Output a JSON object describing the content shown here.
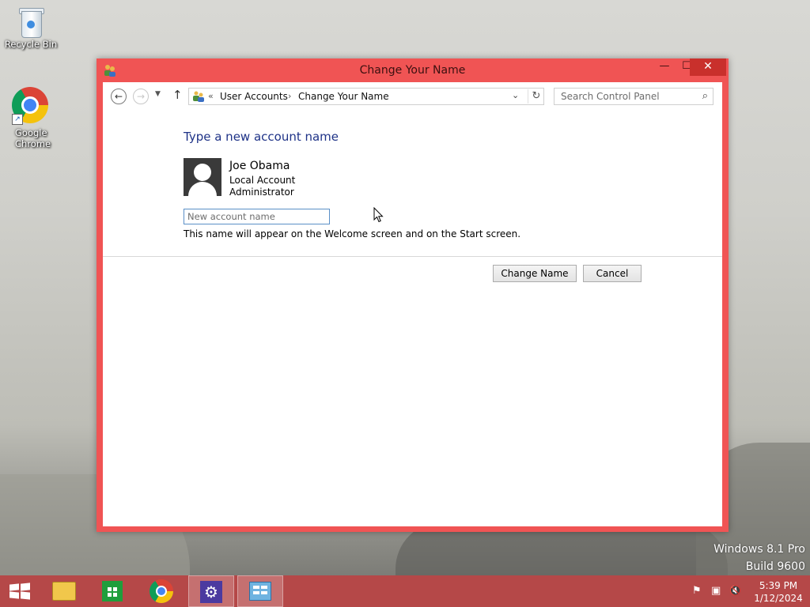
{
  "desktop": {
    "icons": [
      {
        "label": "Recycle Bin"
      },
      {
        "label": "Google Chrome"
      }
    ],
    "watermark": {
      "line1": "Windows 8.1 Pro",
      "line2": "Build 9600"
    }
  },
  "window": {
    "title": "Change Your Name",
    "controls": {
      "minimize": "—",
      "maximize": "☐",
      "close": "✕"
    },
    "nav": {
      "back": "←",
      "forward": "→",
      "recent": "▼",
      "up": "↑",
      "breadcrumb": {
        "overflow": "«",
        "items": [
          "User Accounts",
          "Change Your Name"
        ],
        "separator": "›"
      },
      "dropdown": "⌄",
      "refresh": "↻",
      "search_placeholder": "Search Control Panel",
      "search_icon": "⌕"
    },
    "content": {
      "heading": "Type a new account name",
      "user": {
        "name": "Joe Obama",
        "type": "Local Account",
        "role": "Administrator"
      },
      "input": {
        "value": "",
        "placeholder": "New account name"
      },
      "hint": "This name will appear on the Welcome screen and on the Start screen.",
      "buttons": {
        "change": "Change Name",
        "cancel": "Cancel"
      }
    }
  },
  "taskbar": {
    "items": [
      {
        "name": "start",
        "icon": "windows-logo-icon"
      },
      {
        "name": "file-explorer",
        "icon": "folder-icon"
      },
      {
        "name": "store",
        "icon": "store-icon"
      },
      {
        "name": "chrome",
        "icon": "chrome-icon"
      },
      {
        "name": "settings",
        "icon": "gear-icon",
        "active": true
      },
      {
        "name": "control-panel",
        "icon": "control-panel-icon",
        "active": true
      }
    ],
    "tray": {
      "flag": "⚑",
      "network": "▣",
      "volume": "🔇",
      "time": "5:39 PM",
      "date": "1/12/2024"
    }
  }
}
